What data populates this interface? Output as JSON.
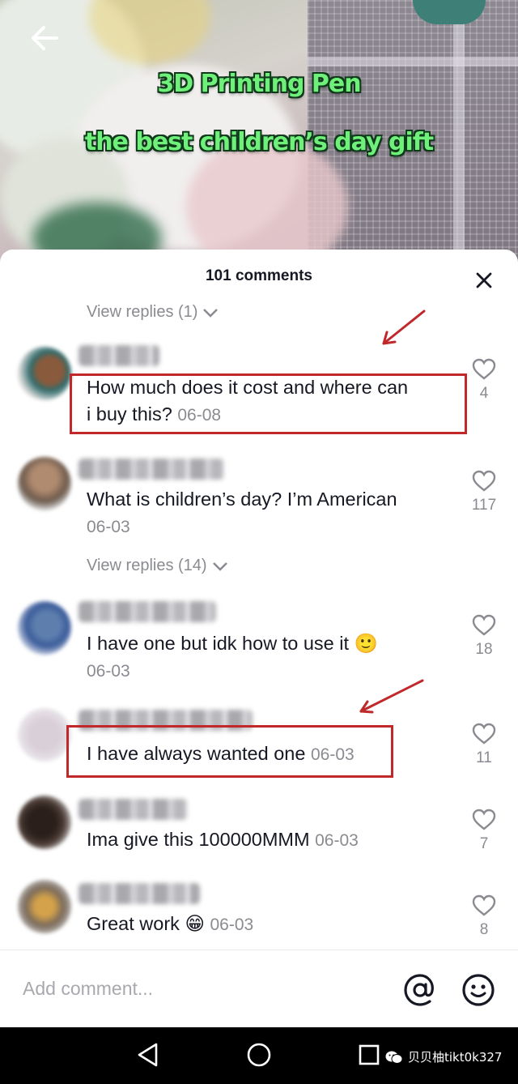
{
  "video": {
    "title_line1": "3D Printing Pen",
    "title_line2": "the best children’s day gift"
  },
  "sheet": {
    "comments_count": "101 comments"
  },
  "view_replies": [
    {
      "label": "View replies (1)"
    },
    {
      "label": "View replies (14)"
    }
  ],
  "comments": [
    {
      "text": "How much does it cost and where can",
      "text2": "i buy this?",
      "date": "06-08",
      "likes": "4",
      "highlighted": true
    },
    {
      "text": "What is children’s day? I’m American",
      "date": "06-03",
      "likes": "117",
      "highlighted": false
    },
    {
      "text": "I have one but idk how to use it 🙂",
      "date": "06-03",
      "likes": "18",
      "highlighted": false
    },
    {
      "text": "I have always wanted one",
      "date": "06-03",
      "likes": "11",
      "highlighted": true
    },
    {
      "text": "Ima give this 100000MMM",
      "date": "06-03",
      "likes": "7",
      "highlighted": false
    },
    {
      "text": "Great work 😁",
      "date": "06-03",
      "likes": "8",
      "highlighted": false
    }
  ],
  "composer": {
    "placeholder": "Add comment..."
  },
  "watermark": {
    "text": "贝贝柚tikt0k327"
  },
  "colors": {
    "highlight": "#c0282a",
    "overlay_text": "#6ef07a",
    "muted": "#8a8b91",
    "primary_text": "#161823"
  },
  "icons": [
    "back-arrow-icon",
    "close-icon",
    "chevron-down-icon",
    "heart-icon",
    "at-sign-icon",
    "emoji-icon",
    "nav-back-icon",
    "nav-home-icon",
    "nav-recent-icon",
    "wechat-icon"
  ]
}
